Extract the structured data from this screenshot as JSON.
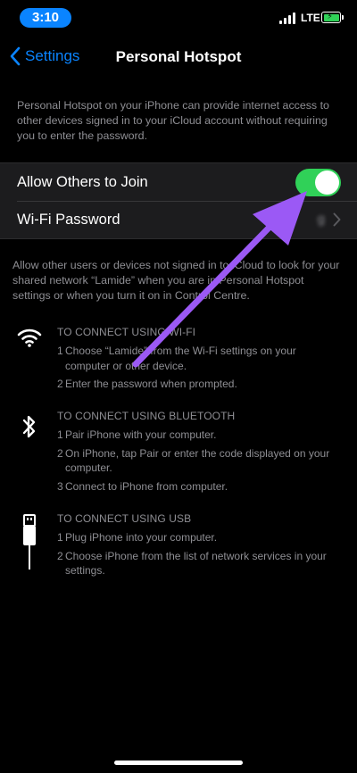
{
  "status_bar": {
    "time": "3:10",
    "network": "LTE"
  },
  "nav": {
    "back_label": "Settings",
    "title": "Personal Hotspot"
  },
  "intro_text": "Personal Hotspot on your iPhone can provide internet access to other devices signed in to your iCloud account without requiring you to enter the password.",
  "settings": {
    "allow_label": "Allow Others to Join",
    "allow_enabled": true,
    "wifi_password_label": "Wi-Fi Password",
    "wifi_password_value": "g"
  },
  "note_text": "Allow other users or devices not signed in to iCloud to look for your shared network “Lamide” when you are in Personal Hotspot settings or when you turn it on in Control Centre.",
  "sections": [
    {
      "heading": "TO CONNECT USING WI-FI",
      "icon": "wifi-icon",
      "steps": [
        "Choose “Lamide” from the Wi-Fi settings on your computer or other device.",
        "Enter the password when prompted."
      ]
    },
    {
      "heading": "TO CONNECT USING BLUETOOTH",
      "icon": "bluetooth-icon",
      "steps": [
        "Pair iPhone with your computer.",
        "On iPhone, tap Pair or enter the code displayed on your computer.",
        "Connect to iPhone from computer."
      ]
    },
    {
      "heading": "TO CONNECT USING USB",
      "icon": "usb-cable-icon",
      "steps": [
        "Plug iPhone into your computer.",
        "Choose iPhone from the list of network services in your settings."
      ]
    }
  ],
  "colors": {
    "accent": "#0a84ff",
    "toggle_on": "#30d158",
    "annotation_arrow": "#9b59f5"
  }
}
